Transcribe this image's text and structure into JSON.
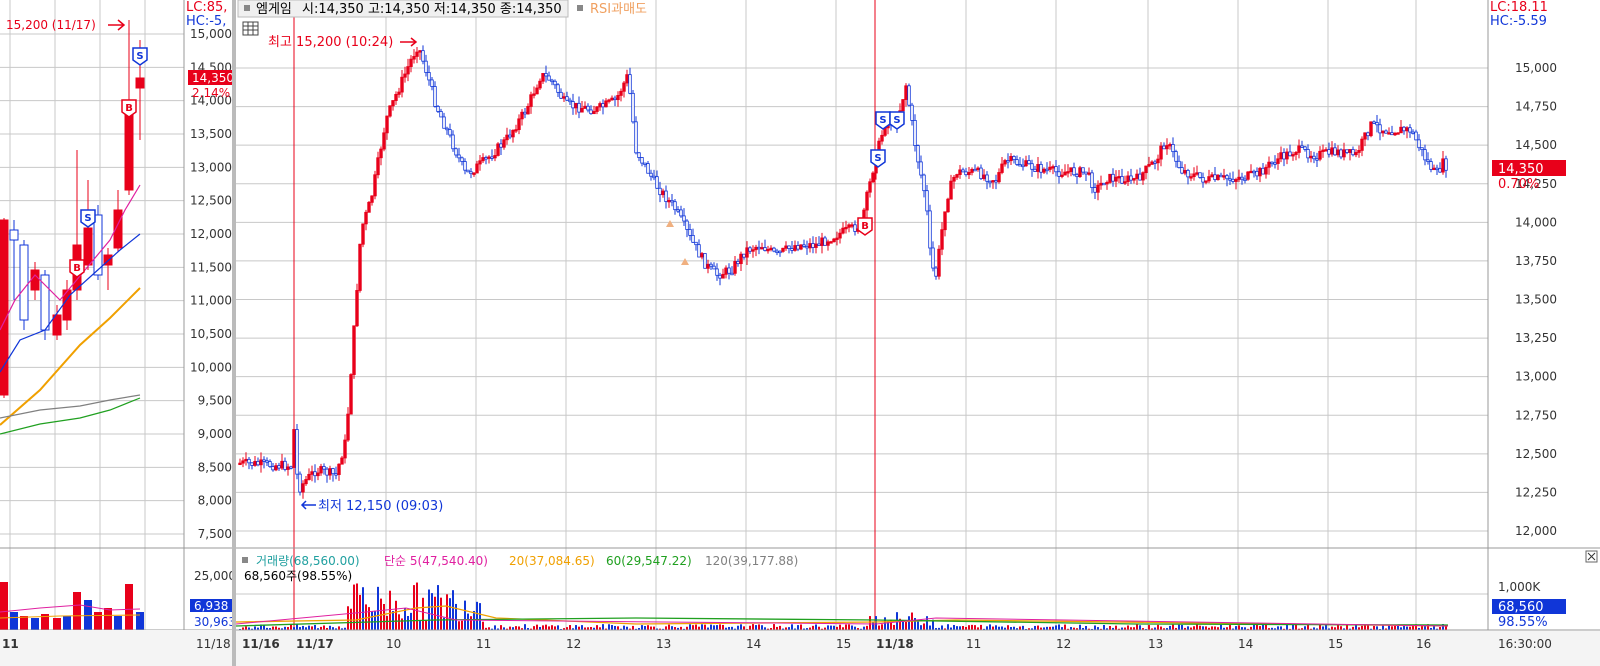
{
  "header": {
    "title": "엠게임",
    "ohlc": "시:14,350 고:14,350 저:14,350 종:14,350",
    "indicator": "RSI과매도"
  },
  "left_panel": {
    "lc": "LC:85,",
    "hc": "HC:-5,",
    "price_tag": "14,350",
    "pct_tag": "2.14%",
    "high_marker": "15,200 (11/17)",
    "y_ticks": [
      "15,000",
      "14,500",
      "14,000",
      "13,500",
      "13,000",
      "12,500",
      "12,000",
      "11,500",
      "11,000",
      "10,500",
      "10,000",
      "9,500",
      "9,000",
      "8,500",
      "8,000",
      "7,500"
    ],
    "vol_ticks": [
      "25,000"
    ],
    "vol_tag": "6,938",
    "vol_pct_tag": "30,963",
    "x_left": "11",
    "x_right": "11/18"
  },
  "main": {
    "lc": "LC:18.11",
    "hc": "HC:-5.59",
    "y_ticks": [
      "15,000",
      "14,750",
      "14,500",
      "14,250",
      "14,000",
      "13,750",
      "13,500",
      "13,250",
      "13,000",
      "12,750",
      "12,500",
      "12,250",
      "12,000"
    ],
    "price_tag": "14,350",
    "pct_tag": "0.70%",
    "high_label": "최고 15,200 (10:24)",
    "low_label": "최저 12,150 (09:03)"
  },
  "volume": {
    "legend": {
      "vol": "거래량(68,560.00)",
      "ma5": "단순 5(47,540.40)",
      "ma20": "20(37,084.65)",
      "ma60": "60(29,547.22)",
      "ma120": "120(39,177.88)"
    },
    "info": "68,560주(98.55%)",
    "axis_tick": "1,000K",
    "vol_tag": "68,560",
    "pct_tag": "98.55%"
  },
  "x_axis": {
    "labels": [
      "11/16",
      "11/17",
      "10",
      "11",
      "12",
      "13",
      "14",
      "15",
      "11/18",
      "11",
      "12",
      "13",
      "14",
      "15",
      "16"
    ],
    "time_label": "16:30:00"
  },
  "colors": {
    "up": "#e8001a",
    "down": "#1036d8",
    "ma5": "#e020a0",
    "ma20": "#f0a000",
    "ma60": "#20a020",
    "ma120": "#808080",
    "grid": "#c8c8c8"
  },
  "chart_data": {
    "type": "candlestick",
    "y_range": [
      11900,
      15300
    ],
    "day_high": 15200,
    "day_low": 12150,
    "last_price": 14350,
    "change_pct": 0.7
  }
}
